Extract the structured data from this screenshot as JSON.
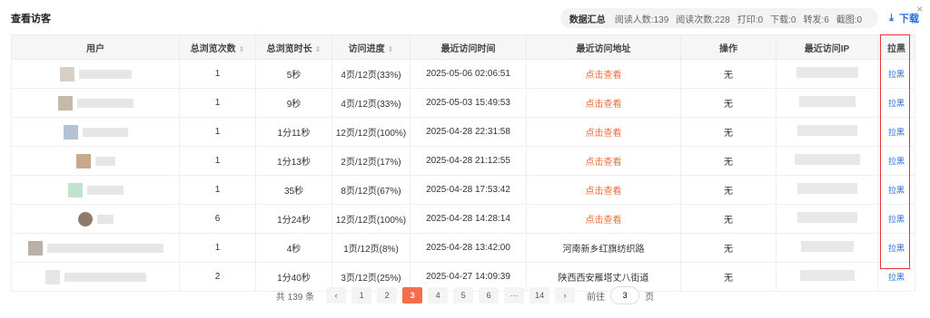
{
  "header": {
    "title": "查看访客",
    "summary_label": "数据汇总",
    "stats": [
      "阅读人数:139",
      "阅读次数:228",
      "打印:0",
      "下载:0",
      "转发:6",
      "截图:0"
    ],
    "download_label": "下载",
    "close_icon": "×"
  },
  "table": {
    "columns": [
      "用户",
      "总浏览次数",
      "总浏览时长",
      "访问进度",
      "最近访问时间",
      "最近访问地址",
      "操作",
      "最近访问IP",
      "拉黑"
    ],
    "sort_icon": "⇕",
    "rows": [
      {
        "views": "1",
        "duration": "5秒",
        "progress": "4页/12页(33%)",
        "time": "2025-05-06 02:06:51",
        "address": "点击查看",
        "address_link": true,
        "action": "无",
        "block": "拉黑",
        "avatar_color": "#d7cfc8",
        "name_w": 58,
        "ip_w": 68
      },
      {
        "views": "1",
        "duration": "9秒",
        "progress": "4页/12页(33%)",
        "time": "2025-05-03 15:49:53",
        "address": "点击查看",
        "address_link": true,
        "action": "无",
        "block": "拉黑",
        "avatar_color": "#c6b8aa",
        "name_w": 62,
        "ip_w": 62
      },
      {
        "views": "1",
        "duration": "1分11秒",
        "progress": "12页/12页(100%)",
        "time": "2025-04-28 22:31:58",
        "address": "点击查看",
        "address_link": true,
        "action": "无",
        "block": "拉黑",
        "avatar_color": "#b4c2d6",
        "name_w": 50,
        "ip_w": 66
      },
      {
        "views": "1",
        "duration": "1分13秒",
        "progress": "2页/12页(17%)",
        "time": "2025-04-28 21:12:55",
        "address": "点击查看",
        "address_link": true,
        "action": "无",
        "block": "拉黑",
        "avatar_color": "#c7a98c",
        "name_w": 22,
        "ip_w": 72
      },
      {
        "views": "1",
        "duration": "35秒",
        "progress": "8页/12页(67%)",
        "time": "2025-04-28 17:53:42",
        "address": "点击查看",
        "address_link": true,
        "action": "无",
        "block": "拉黑",
        "avatar_color": "#bfe3cc",
        "name_w": 40,
        "ip_w": 66
      },
      {
        "views": "6",
        "duration": "1分24秒",
        "progress": "12页/12页(100%)",
        "time": "2025-04-28 14:28:14",
        "address": "点击查看",
        "address_link": true,
        "action": "无",
        "block": "拉黑",
        "avatar_color": "#8e7c6a",
        "name_w": 18,
        "ip_w": 66,
        "round": true
      },
      {
        "views": "1",
        "duration": "4秒",
        "progress": "1页/12页(8%)",
        "time": "2025-04-28 13:42:00",
        "address": "河南新乡红旗纺织路",
        "address_link": false,
        "action": "无",
        "block": "拉黑",
        "avatar_color": "#b9b0aa",
        "name_w": 128,
        "ip_w": 58
      },
      {
        "views": "2",
        "duration": "1分40秒",
        "progress": "3页/12页(25%)",
        "time": "2025-04-27 14:09:39",
        "address": "陕西西安雁塔丈八街道",
        "address_link": false,
        "action": "无",
        "block": "拉黑",
        "avatar_color": "#e6e6e6",
        "name_w": 90,
        "ip_w": 60
      }
    ]
  },
  "pager": {
    "total": "共 139 条",
    "prev": "‹",
    "next": "›",
    "pages": [
      "1",
      "2",
      "3",
      "4",
      "5",
      "6",
      "···",
      "14"
    ],
    "current": "3",
    "goto_label": "前往",
    "goto_value": "3",
    "page_suffix": "页"
  },
  "colors": {
    "accent": "#f26e4e",
    "link": "#2a6fd6",
    "highlight_box": "#e33333"
  }
}
